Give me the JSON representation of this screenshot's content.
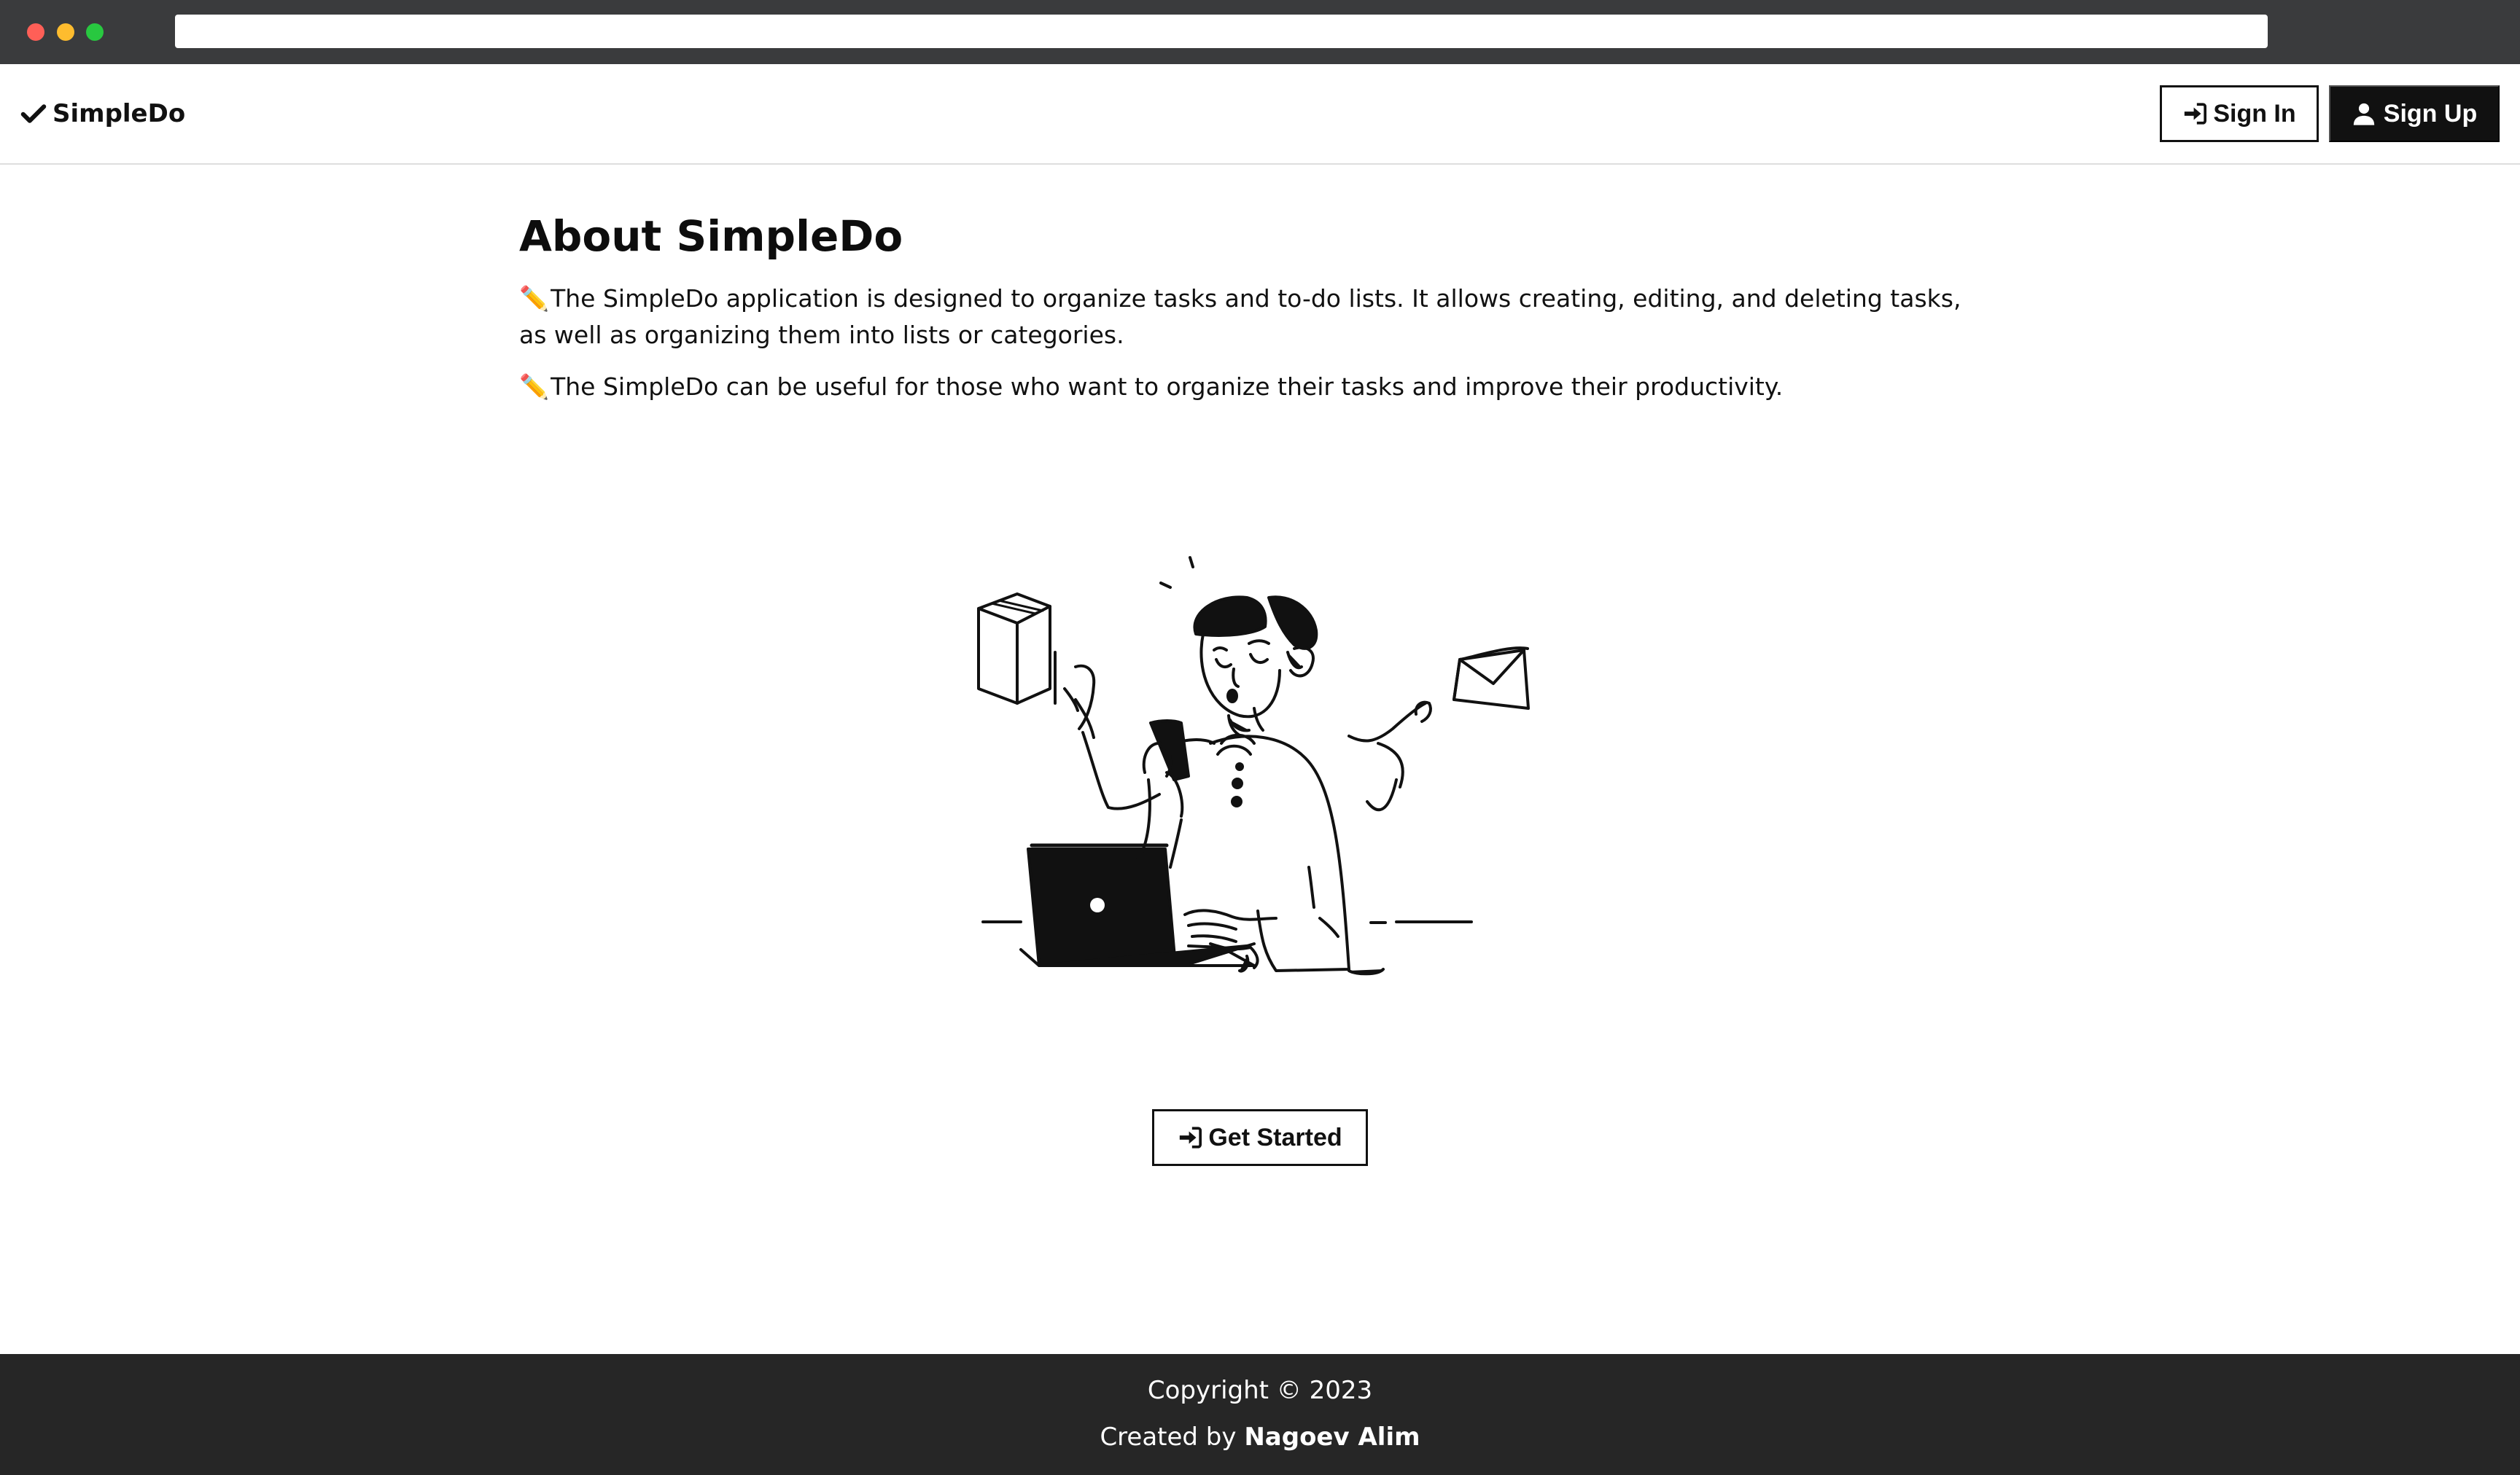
{
  "browser": {
    "url": ""
  },
  "navbar": {
    "brand": "SimpleDo",
    "signin_label": "Sign In",
    "signup_label": "Sign Up",
    "icons": {
      "brand": "check-icon",
      "signin": "sign-in-icon",
      "signup": "user-icon"
    }
  },
  "main": {
    "title": "About SimpleDo",
    "paragraphs": [
      "The SimpleDo application is designed to organize tasks and to-do lists. It allows creating, editing, and deleting tasks, as well as organizing them into lists or categories.",
      "The SimpleDo can be useful for those who want to organize their tasks and improve their productivity."
    ],
    "paragraph_icon": "✏️",
    "illustration": "multitasking-person-illustration",
    "cta_label": "Get Started"
  },
  "footer": {
    "copyright": "Copyright © 2023",
    "created_prefix": "Created by",
    "author": "Nagoev Alim"
  },
  "colors": {
    "primary": "#111111",
    "footer_bg": "#262626",
    "chrome_bg": "#3a3b3d"
  }
}
